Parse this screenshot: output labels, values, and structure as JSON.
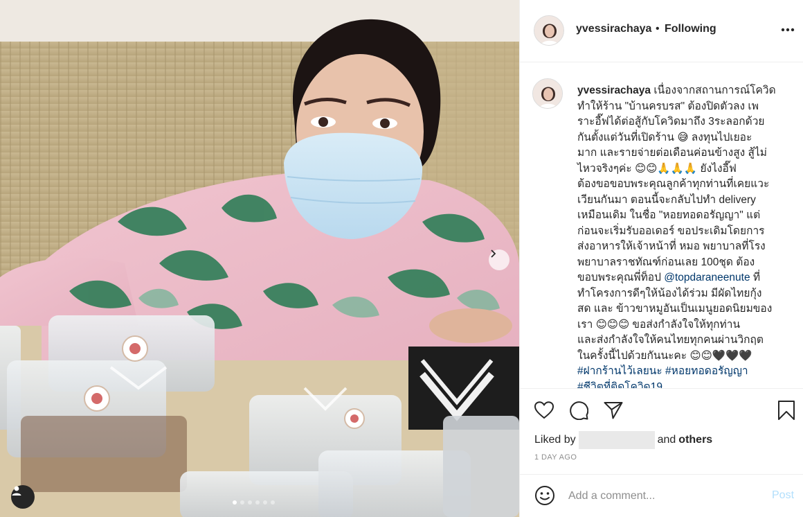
{
  "post": {
    "username": "yvessirachaya",
    "separator": "•",
    "follow_status": "Following",
    "more_icon": "more-horizontal-icon"
  },
  "caption": {
    "username": "yvessirachaya",
    "line1": " เนื่องจากสถานการณ์โควิด",
    "line2": "ทำให้ร้าน \"บ้านครบรส\" ต้องปิดตัวลง เพ",
    "line3": "ราะอี๊ฟได้ต่อสู้กับโควิดมาถึง 3ระลอกด้วย",
    "line4": "กันตั้งแต่วันที่เปิดร้าน 😅 ลงทุนไปเยอะ",
    "line5": "มาก และรายจ่ายต่อเดือนค่อนข้างสูง สู้ไม่",
    "line6": "ไหวจริงๆค่ะ 😊😊🙏🙏🙏 ยังไงอี๊ฟ",
    "line7": "ต้องขอขอบพระคุณลูกค้าทุกท่านที่เคยแวะ",
    "line8": "เวียนกันมา ตอนนี้จะกลับไปทำ delivery",
    "line9": "เหมือนเดิม ในชื่อ \"หอยทอดอรัญญา\" แต่",
    "line10": "ก่อนจะเริ่มรับออเดอร์ ขอประเดิมโดยการ",
    "line11": "ส่งอาหารให้เจ้าหน้าที่ หมอ พยาบาลที่โรง",
    "line12": "พยาบาลราชทัณฑ์ก่อนเลย 100ชุด ต้อง",
    "line13a": "ขอบพระคุณพี่ท็อป ",
    "mention": "@topdaraneenute",
    "line13b": " ที่",
    "line14": "ทำโครงการดีๆให้น้องได้ร่วม มีผัดไทยกุ้ง",
    "line15": "สด และ ข้าวขาหมูอันเป็นเมนูยอดนิยมของ",
    "line16": "เรา 😊😊😊 ขอส่งกำลังใจให้ทุกท่าน",
    "line17": "และส่งกำลังใจให้คนไทยทุกคนผ่านวิกฤต",
    "line18": "ในครั้งนี้ไปด้วยกันนะคะ 😊😊🖤🖤🖤",
    "hashtag1": "#ฝากร้านไว้เลยนะ",
    "hashtag2": "#หอยทอดอรัญญา",
    "hashtag3": "#ชีวิตที่ติดโควิด19"
  },
  "actions": {
    "like_icon": "heart-icon",
    "comment_icon": "comment-icon",
    "share_icon": "share-icon",
    "save_icon": "bookmark-icon"
  },
  "likes": {
    "prefix": "Liked by",
    "middle": "and",
    "suffix": "others"
  },
  "time_ago": "1 DAY AGO",
  "comment": {
    "placeholder": "Add a comment...",
    "post_label": "Post",
    "emoji_icon": "emoji-icon"
  },
  "carousel": {
    "slide_count": 6,
    "active_index": 0
  },
  "colors": {
    "link": "#00376b",
    "post_disabled": "#b2dffc",
    "muted": "#8e8e8e",
    "text": "#262626"
  }
}
